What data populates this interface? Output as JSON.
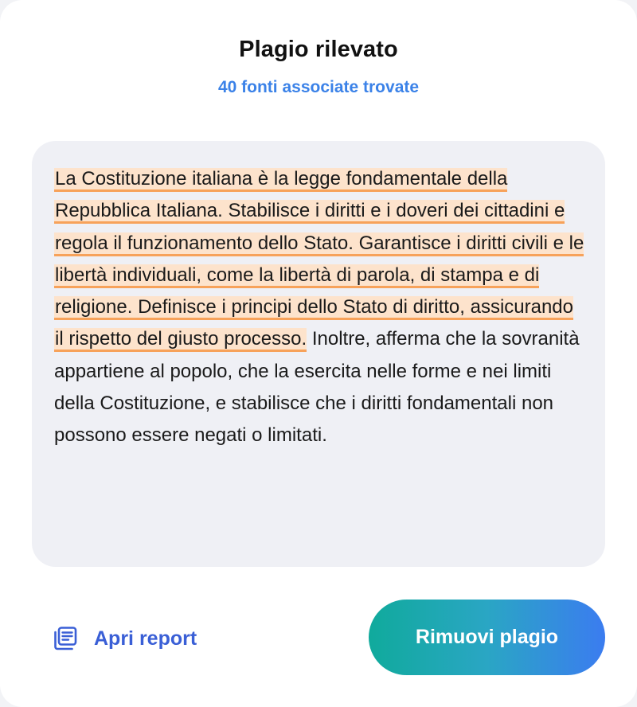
{
  "header": {
    "title": "Plagio rilevato",
    "subtitle": "40 fonti associate trovate"
  },
  "content": {
    "highlighted_text": "La Costituzione italiana è la legge fondamentale della Repubblica Italiana. Stabilisce i diritti e i doveri dei cittadini e regola il funzionamento dello Stato. Garantisce i diritti civili e le libertà individuali, come la libertà di parola, di stampa e di religione. Definisce i principi dello Stato di diritto, assicurando il rispetto del giusto processo.",
    "plain_text": " Inoltre, afferma che la sovranità appartiene al popolo, che la esercita nelle forme e nei limiti della Costituzione, e stabilisce che i diritti fondamentali non possono essere negati o limitati."
  },
  "actions": {
    "report_label": "Apri report",
    "report_icon": "document-list-icon",
    "remove_label": "Rimuovi plagio"
  },
  "colors": {
    "accent": "#3b82e8",
    "highlight_fill": "#fde3cc",
    "highlight_underline": "#f7a25a",
    "button_gradient_start": "#10aa9c",
    "button_gradient_end": "#3b7cf0"
  }
}
